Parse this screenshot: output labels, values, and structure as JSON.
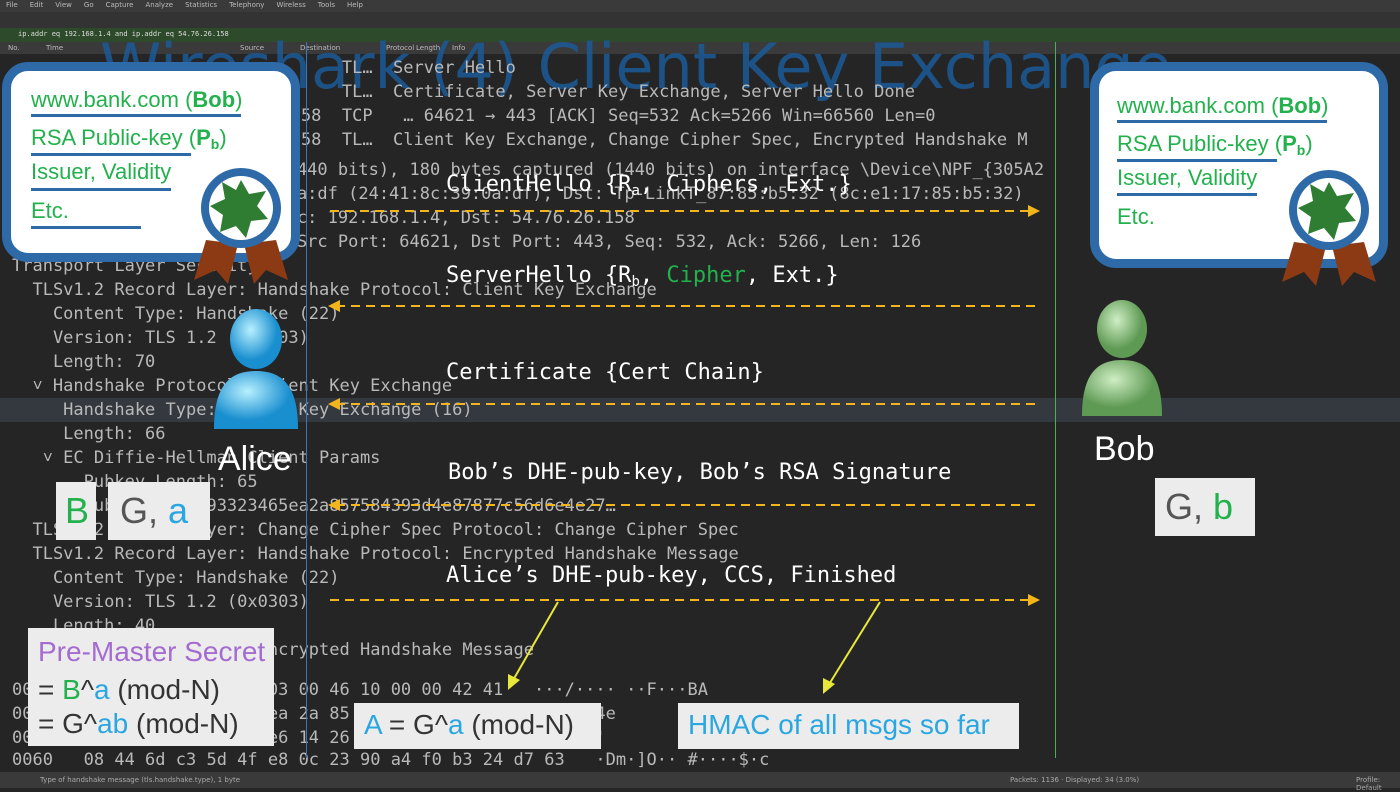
{
  "title": "Wireshark (4) Client Key Exchange",
  "wireshark": {
    "menu": [
      "File",
      "Edit",
      "View",
      "Go",
      "Capture",
      "Analyze",
      "Statistics",
      "Telephony",
      "Wireless",
      "Tools",
      "Help"
    ],
    "filter": "ip.addr eq 192.168.1.4 and ip.addr eq 54.76.26.158",
    "columns": [
      "No.",
      "Time",
      "Source",
      "Destination",
      "Protocol",
      "Length",
      "Info"
    ],
    "packets": [
      "        TL…  Server Hello",
      "        TL…  Certificate, Server Key Exchange, Server Hello Done",
      "26.158  TCP   … 64621 → 443 [ACK] Seq=532 Ack=5266 Win=66560 Len=0",
      "26.158  TL…  Client Key Exchange, Change Cipher Spec, Encrypted Handshake M"
    ],
    "details": [
      "e (1440 bits), 180 bytes captured (1440 bits) on interface \\Device\\NPF_{305A2",
      "39:0a:df (24:41:8c:39:0a:df), Dst: Tp-LinkT_87:85:b5:32 (8c:e1:17:85:b5:32)",
      ", Src: 192.168.1.4, Dst: 54.76.26.158",
      "ol, Src Port: 64621, Dst Port: 443, Seq: 532, Ack: 5266, Len: 126",
      "Transport Layer Security",
      "  TLSv1.2 Record Layer: Handshake Protocol: Client Key Exchange",
      "    Content Type: Handshake (22)",
      "    Version: TLS 1.2 (0x0303)",
      "    Length: 70",
      "  ˅ Handshake Protocol: Client Key Exchange",
      "     Handshake Type: Client Key Exchange (16)",
      "     Length: 66",
      "   ˅ EC Diffie-Hellman Client Params",
      "       Pubkey Length: 65",
      "       Pubkey: 045c93323465ea2a857584393d4e87877c56d6e4e27…",
      "  TLSv1.2 Record Layer: Change Cipher Spec Protocol: Change Cipher Spec",
      "  TLSv1.2 Record Layer: Handshake Protocol: Encrypted Handshake Message",
      "    Content Type: Handshake (22)",
      "    Version: TLS 1.2 (0x0303)",
      "    Length: 40",
      "    Handshake Protocol: Encrypted Handshake Message"
    ],
    "hex": [
      "0030   00 00 10 46 16 03 03 00 46 10 00 00 42 41   ···/···· ··F···BA",
      "0040   2a 85 75 84 39 65 ea 2a 85 75 84 39 3d 4e   *2rl·24e",
      "0050   4e 87 87 7c 56 27 e6 14 26 e4 e2 78 77 1a   xw·mnN'",
      "0060   08 44 6d c3 5d 4f e8 0c 23 90 a4 f0 b3 24 d7 63   ·Dm·]O·· #····$·c"
    ],
    "status": [
      "Type of handshake message (tls.handshake.type), 1 byte",
      "Packets: 1136 · Displayed: 34 (3.0%)",
      "Profile: Default"
    ]
  },
  "certificate": {
    "domain": "www.bank.com",
    "owner": "Bob",
    "key_label": "RSA Public-key",
    "key_symbol": "P",
    "key_sub": "b",
    "line3": "Issuer, Validity",
    "line4": "Etc."
  },
  "alice": {
    "name": "Alice",
    "secret_b": "B",
    "g": "G,",
    "a": "a"
  },
  "bob": {
    "name": "Bob",
    "g": "G,",
    "b": "b"
  },
  "messages": {
    "client_hello": {
      "pre": "ClientHello {R",
      "sub": "a",
      "post": ", Ciphers, Ext.}"
    },
    "server_hello": {
      "pre": "ServerHello {R",
      "sub": "b",
      "mid": ", ",
      "cipher": "Cipher",
      "post": ", Ext.}"
    },
    "certificate": "Certificate {Cert Chain}",
    "server_key": "Bob’s DHE-pub-key, Bob’s RSA Signature",
    "client_key": "Alice’s DHE-pub-key, CCS, Finished"
  },
  "premaster": {
    "title": "Pre-Master Secret",
    "eq": "=",
    "l1_b": "B",
    "l1_hat": "^",
    "l1_a": "a",
    "l1_mod": " (mod-N)",
    "l2_g": "G^",
    "l2_ab": "ab",
    "l2_mod": " (mod-N)"
  },
  "alice_pub": {
    "lhs": "A",
    "eq": " = G^",
    "a": "a",
    "mod": " (mod-N)"
  },
  "hmac": "HMAC of all msgs so far",
  "colors": {
    "arrow": "#f2b61c",
    "pointer": "#e8e83a",
    "green": "#22b14c",
    "blue": "#2aa7e0",
    "purple": "#a46bd0",
    "cert_border": "#2f6aa8"
  }
}
